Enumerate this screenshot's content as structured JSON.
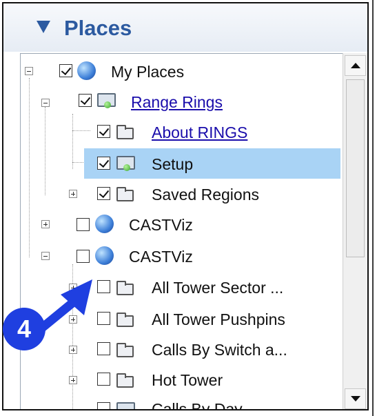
{
  "header": {
    "title": "Places"
  },
  "tree": [
    {
      "key": "my_places",
      "label": "My Places",
      "checked": true,
      "icon": "globe-icon",
      "expanded": true
    },
    {
      "key": "range_rings",
      "label": "Range Rings",
      "checked": true,
      "icon": "network-folder-icon",
      "link": true,
      "expanded": true
    },
    {
      "key": "about_rings",
      "label": "About RINGS",
      "checked": true,
      "icon": "folder-icon",
      "link": true
    },
    {
      "key": "setup",
      "label": "Setup",
      "checked": true,
      "icon": "network-folder-icon",
      "selected": true
    },
    {
      "key": "saved_regions",
      "label": "Saved Regions",
      "checked": true,
      "icon": "folder-icon",
      "expanded": false
    },
    {
      "key": "castviz_1",
      "label": "CASTViz",
      "checked": false,
      "icon": "globe-icon",
      "expanded": false
    },
    {
      "key": "castviz_2",
      "label": "CASTViz",
      "checked": false,
      "icon": "globe-icon",
      "expanded": true
    },
    {
      "key": "all_tower_sector",
      "label": "All Tower Sector ...",
      "checked": false,
      "icon": "folder-icon",
      "expanded": false
    },
    {
      "key": "all_tower_pushpins",
      "label": "All Tower Pushpins",
      "checked": false,
      "icon": "folder-icon",
      "expanded": false
    },
    {
      "key": "calls_by_switch",
      "label": "Calls By Switch a...",
      "checked": false,
      "icon": "folder-icon",
      "expanded": false
    },
    {
      "key": "hot_tower",
      "label": "Hot Tower",
      "checked": false,
      "icon": "folder-icon",
      "expanded": false
    },
    {
      "key": "calls_by_day",
      "label": "Calls By Day",
      "checked": false,
      "icon": "network-folder-icon"
    }
  ],
  "annotation": {
    "step": "4",
    "color": "#1f3fe0"
  },
  "colors": {
    "header_text": "#2c5aa0",
    "selection": "#a9d3f5",
    "link": "#1a0dab"
  }
}
